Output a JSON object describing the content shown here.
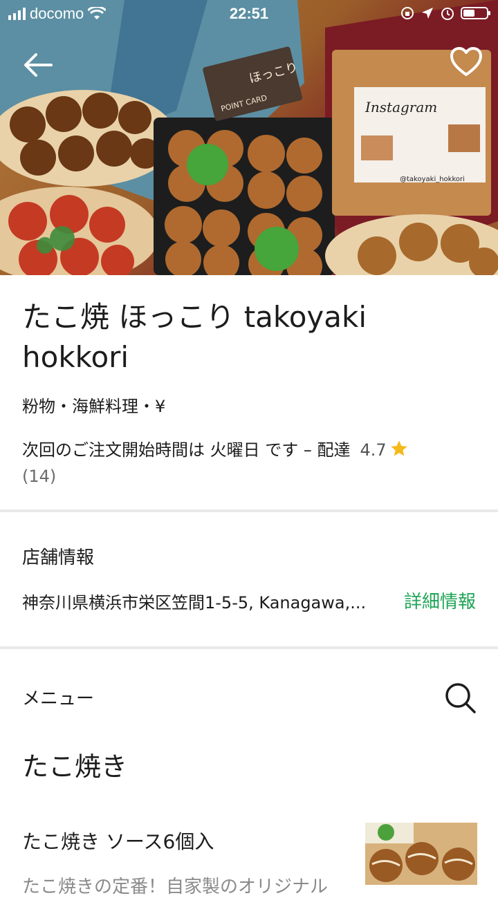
{
  "status_bar": {
    "carrier": "docomo",
    "time": "22:51",
    "icons": [
      "signal-icon",
      "wifi-icon",
      "orientation-lock-icon",
      "location-icon",
      "alarm-icon",
      "battery-icon"
    ]
  },
  "hero": {
    "image_text": {
      "card_title": "POINT CARD",
      "card_brand": "ほっこり",
      "instagram": "Instagram",
      "instagram_handle": "@takoyaki_hokkori"
    },
    "icons": {
      "back": "back-arrow-icon",
      "favorite": "heart-icon"
    }
  },
  "store": {
    "name": "たこ焼 ほっこり takoyaki hokkori",
    "categories": "粉物・海鮮料理・¥",
    "next_order": "次回のご注文開始時間は 火曜日 です – 配達",
    "rating": "4.7",
    "rating_count": "(14)"
  },
  "store_info": {
    "label": "店舗情報",
    "address": "神奈川県横浜市栄区笠間1-5-5, Kanagawa,...",
    "details_link": "詳細情報"
  },
  "menu": {
    "label": "メニュー",
    "category": "たこ焼き",
    "items": [
      {
        "name": "たこ焼き ソース6個入",
        "description": "たこ焼きの定番！自家製のオリジナル"
      }
    ]
  },
  "colors": {
    "accent_green": "#1fa455",
    "star": "#f6b91c",
    "divider": "#e9e9e9",
    "text_primary": "#1c1c1c",
    "text_secondary": "#8a8a8a"
  }
}
